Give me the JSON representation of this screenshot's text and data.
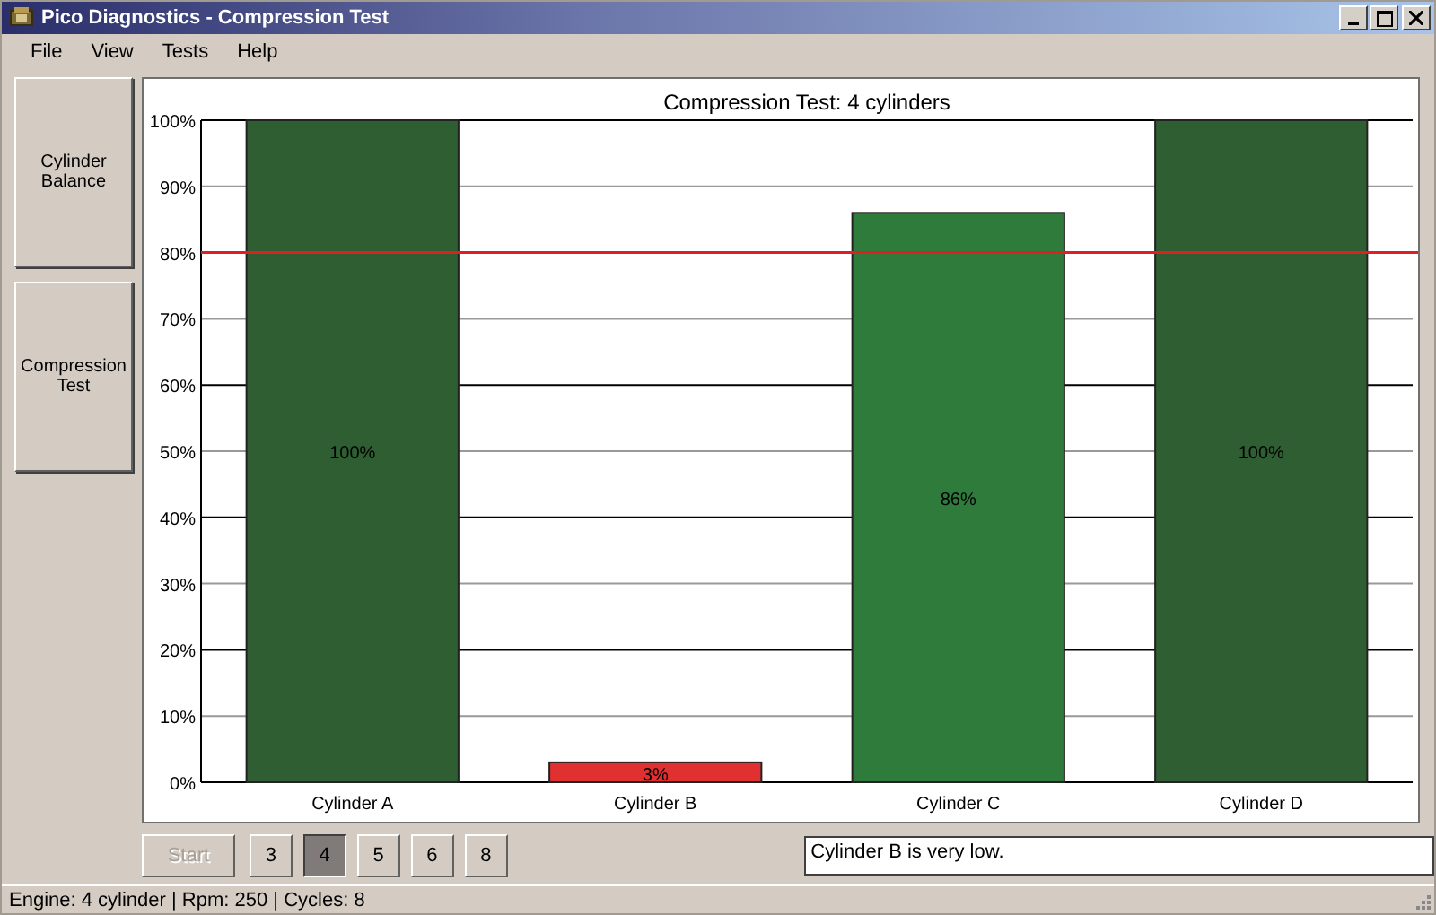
{
  "window": {
    "title": "Pico Diagnostics - Compression Test"
  },
  "menu": [
    "File",
    "View",
    "Tests",
    "Help"
  ],
  "tests": [
    {
      "label": "Cylinder Balance"
    },
    {
      "label": "Compression Test"
    }
  ],
  "chart": {
    "chart_data": {
      "type": "bar",
      "title": "Compression Test: 4 cylinders",
      "categories": [
        "Cylinder A",
        "Cylinder B",
        "Cylinder C",
        "Cylinder D"
      ],
      "series": [
        {
          "color": "#2e5e32",
          "values": [
            100,
            null,
            null,
            100
          ]
        },
        {
          "color": "#e03030",
          "values": [
            null,
            3,
            null,
            null
          ]
        },
        {
          "color": "#2f7b3c",
          "values": [
            null,
            null,
            86,
            null
          ]
        }
      ],
      "grid": true,
      "value_labels": [
        "100%",
        "3%",
        "86%",
        "100%"
      ],
      "ylim": [
        0,
        100
      ],
      "yticks": [
        {
          "value": 0,
          "label": "0%"
        },
        {
          "value": 10,
          "label": "10%"
        },
        {
          "value": 20,
          "label": "20%"
        },
        {
          "value": 30,
          "label": "30%"
        },
        {
          "value": 40,
          "label": "40%"
        },
        {
          "value": 50,
          "label": "50%"
        },
        {
          "value": 60,
          "label": "60%"
        },
        {
          "value": 70,
          "label": "70%"
        },
        {
          "value": 80,
          "label": "80%"
        },
        {
          "value": 90,
          "label": "90%"
        },
        {
          "value": 100,
          "label": "100%"
        }
      ],
      "ref_lines": [
        {
          "axis": "y",
          "value": 80,
          "color": "#e02020"
        }
      ]
    }
  },
  "start": {
    "label": "Start",
    "disabled": true
  },
  "cylinder_counts": [
    {
      "label": "3",
      "selected": false
    },
    {
      "label": "4",
      "selected": true
    },
    {
      "label": "5",
      "selected": false
    },
    {
      "label": "6",
      "selected": false
    },
    {
      "label": "8",
      "selected": false
    }
  ],
  "message": "Cylinder B is very low.",
  "status_bar": "Engine: 4 cylinder | Rpm: 250 | Cycles: 8"
}
